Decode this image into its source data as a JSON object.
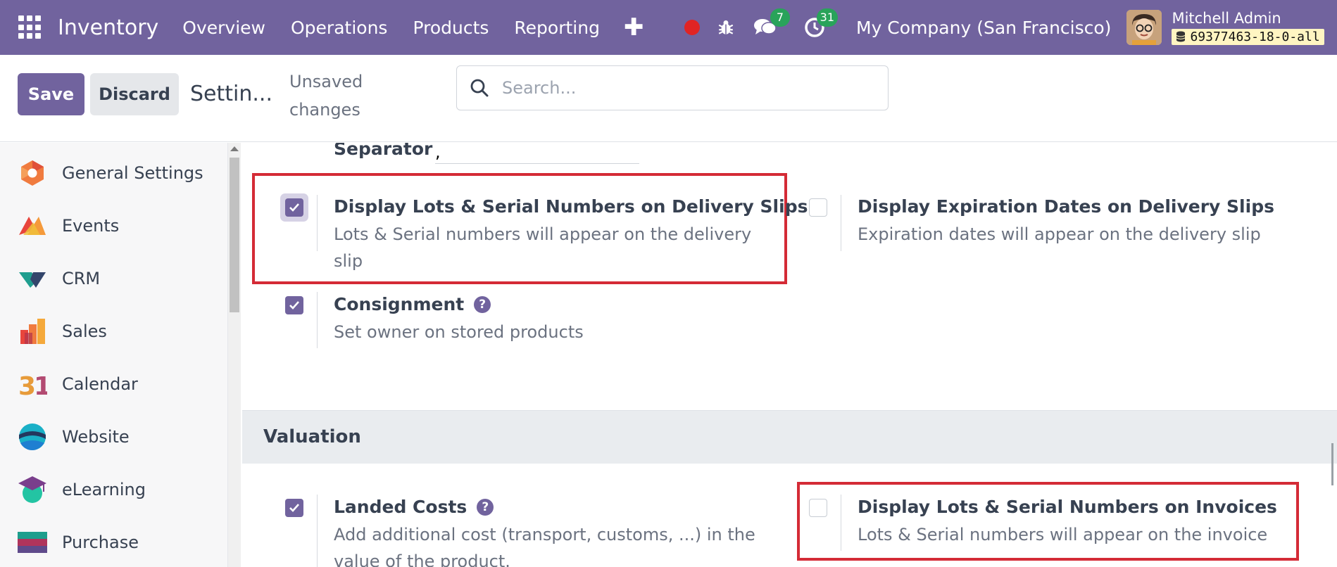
{
  "navbar": {
    "app_name": "Inventory",
    "menu": [
      "Overview",
      "Operations",
      "Products",
      "Reporting"
    ],
    "plus_icon": "plus-icon",
    "messages_count": "7",
    "activities_count": "31",
    "company": "My Company (San Francisco)",
    "user_name": "Mitchell Admin",
    "database": "69377463-18-0-all",
    "colors": {
      "navbar": "#71639e",
      "badge": "#29a35a",
      "record": "#e02424"
    }
  },
  "control": {
    "save_label": "Save",
    "discard_label": "Discard",
    "title": "Settin...",
    "unsaved": "Unsaved changes",
    "search_placeholder": "Search..."
  },
  "sidebar": {
    "items": [
      {
        "label": "General Settings",
        "icon": "general-settings-icon"
      },
      {
        "label": "Events",
        "icon": "events-icon"
      },
      {
        "label": "CRM",
        "icon": "crm-icon"
      },
      {
        "label": "Sales",
        "icon": "sales-icon"
      },
      {
        "label": "Calendar",
        "icon": "calendar-icon"
      },
      {
        "label": "Website",
        "icon": "website-icon"
      },
      {
        "label": "eLearning",
        "icon": "elearning-icon"
      },
      {
        "label": "Purchase",
        "icon": "purchase-icon"
      }
    ]
  },
  "main": {
    "separator_label": "Separator",
    "separator_value": ",",
    "settings": {
      "lots_delivery": {
        "title": "Display Lots & Serial Numbers on Delivery Slips",
        "desc": "Lots & Serial numbers will appear on the delivery slip",
        "checked": true
      },
      "expiration_delivery": {
        "title": "Display Expiration Dates on Delivery Slips",
        "desc": "Expiration dates will appear on the delivery slip",
        "checked": false
      },
      "consignment": {
        "title": "Consignment",
        "desc": "Set owner on stored products",
        "checked": true
      },
      "landed_costs": {
        "title": "Landed Costs",
        "desc": "Add additional cost (transport, customs, ...) in the value of the product.",
        "checked": true
      },
      "lots_invoices": {
        "title": "Display Lots & Serial Numbers on Invoices",
        "desc": "Lots & Serial numbers will appear on the invoice",
        "checked": false
      }
    },
    "valuation_heading": "Valuation",
    "highlight_color": "#d42b36"
  }
}
